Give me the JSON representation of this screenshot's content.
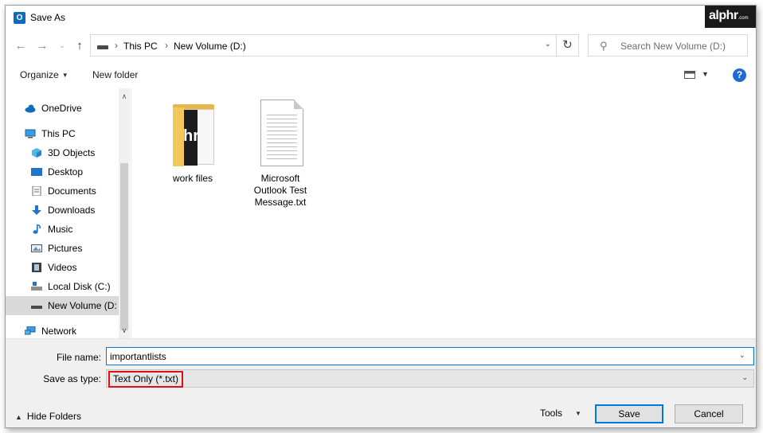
{
  "window": {
    "title": "Save As",
    "brand": "alphr",
    "brand_suffix": ".com"
  },
  "address": {
    "crumbs": [
      "This PC",
      "New Volume (D:)"
    ],
    "search_placeholder": "Search New Volume (D:)"
  },
  "toolbar": {
    "organize": "Organize",
    "new_folder": "New folder",
    "help": "?"
  },
  "nav": {
    "items": [
      {
        "label": "OneDrive",
        "icon": "cloud-icon"
      },
      {
        "label": "This PC",
        "icon": "computer-icon"
      },
      {
        "label": "3D Objects",
        "icon": "cube-icon"
      },
      {
        "label": "Desktop",
        "icon": "desktop-icon"
      },
      {
        "label": "Documents",
        "icon": "document-icon"
      },
      {
        "label": "Downloads",
        "icon": "download-icon"
      },
      {
        "label": "Music",
        "icon": "music-note-icon"
      },
      {
        "label": "Pictures",
        "icon": "picture-icon"
      },
      {
        "label": "Videos",
        "icon": "film-icon"
      },
      {
        "label": "Local Disk (C:)",
        "icon": "drive-icon"
      },
      {
        "label": "New Volume (D:",
        "icon": "drive-icon"
      },
      {
        "label": "Network",
        "icon": "network-icon"
      }
    ]
  },
  "files": [
    {
      "name": "work files",
      "type": "folder"
    },
    {
      "name": "Microsoft Outlook Test Message.txt",
      "type": "text-document"
    }
  ],
  "form": {
    "file_name_label": "File name:",
    "file_name_value": "importantlists",
    "save_type_label": "Save as type:",
    "save_type_value": "Text Only (*.txt)"
  },
  "footer": {
    "hide_folders": "Hide Folders",
    "tools": "Tools",
    "save": "Save",
    "cancel": "Cancel"
  },
  "colors": {
    "accent": "#0078d7",
    "highlight_border": "#e01010",
    "folder": "#e9b64a"
  }
}
